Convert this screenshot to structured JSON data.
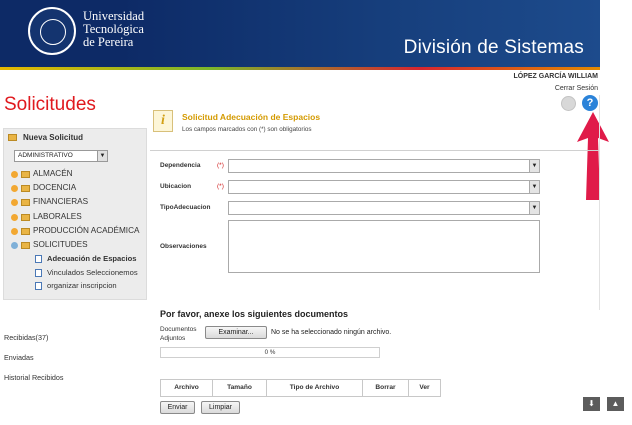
{
  "header": {
    "logo_lines": [
      "Universidad",
      "Tecnológica",
      "de Pereira"
    ],
    "division_title": "División de Sistemas"
  },
  "user": {
    "name": "LÓPEZ GARCÍA WILLIAM",
    "logout": "Cerrar Sesión",
    "help_symbol": "?"
  },
  "page_title": "Solicitudes",
  "sidebar": {
    "header": "Nueva Solicitud",
    "dependency_select": "ADMINISTRATIVO",
    "tree": [
      {
        "label": "ALMACÉN"
      },
      {
        "label": "DOCENCIA"
      },
      {
        "label": "FINANCIERAS"
      },
      {
        "label": "LABORALES"
      },
      {
        "label": "PRODUCCIÓN ACADÉMICA"
      },
      {
        "label": "SOLICITUDES"
      }
    ],
    "subtree": [
      {
        "label": "Adecuación de Espacios"
      },
      {
        "label": "Vinculados Seleccionemos"
      },
      {
        "label": "organizar inscripcion"
      }
    ],
    "links": {
      "received": "Recibidas(37)",
      "sent": "Enviadas",
      "history": "Historial Recibidos"
    }
  },
  "form": {
    "title": "Solicitud Adecuación de Espacios",
    "subtitle": "Los campos marcados con (*) son obligatorios",
    "required_mark": "(*)",
    "fields": {
      "dependencia": "Dependencia",
      "ubicacion": "Ubicacion",
      "tipo": "TipoAdecuacion",
      "observaciones": "Observaciones"
    },
    "attachments": {
      "title": "Por favor, anexe los siguientes documentos",
      "label": "Documentos Adjuntos",
      "browse": "Examinar...",
      "no_file": "No se ha seleccionado ningún archivo.",
      "progress": "0 %",
      "columns": [
        "Archivo",
        "Tamaño",
        "Tipo de Archivo",
        "Borrar",
        "Ver"
      ]
    },
    "buttons": {
      "send": "Enviar",
      "clear": "Limpiar"
    }
  },
  "colors": {
    "header_blue": "#0d2a66",
    "title_red": "#e0191e",
    "form_title_orange": "#d49a00",
    "arrow_red": "#e01b49"
  }
}
